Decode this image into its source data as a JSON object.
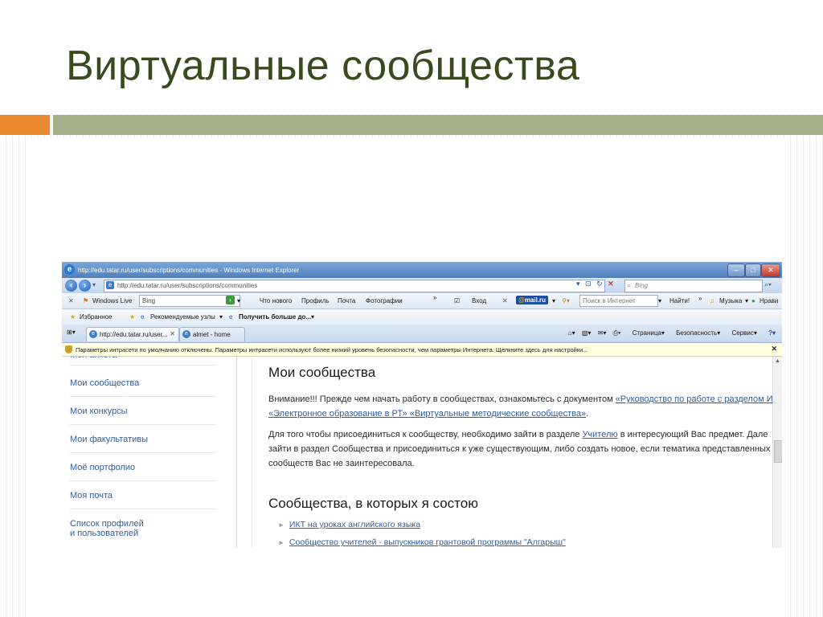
{
  "slide": {
    "title": "Виртуальные сообщества",
    "colors": {
      "title": "#3a4a1f",
      "bar_orange": "#e98b2e",
      "bar_green": "#a3b08a"
    }
  },
  "window": {
    "title": "http://edu.tatar.ru/user/subscriptions/communities - Windows Internet Explorer",
    "controls": {
      "minimize": "–",
      "maximize": "□",
      "close": "✕"
    }
  },
  "address_bar": {
    "url": "http://edu.tatar.ru/user/subscriptions/communities",
    "search_placeholder": "Bing"
  },
  "live_toolbar": {
    "close": "✕",
    "brand": "Windows Live",
    "search_value": "Bing",
    "links": [
      "Что нового",
      "Профиль",
      "Почта",
      "Фотографии"
    ],
    "more": "»",
    "login": "Вход",
    "close2": "✕",
    "mail_prefix": "@",
    "mail_brand": "mail",
    "mail_suffix": ".ru",
    "mail_search_placeholder": "Поиск в Интернет",
    "find_button": "Найти!",
    "more2": "»",
    "music": "Музыка",
    "like": "Нрави"
  },
  "favorites_bar": {
    "favorites": "Избранное",
    "suggested": "Рекомендуемые узлы",
    "get_more": "Получить больше до..."
  },
  "tabs": [
    {
      "label": "http://edu.tatar.ru/user..."
    },
    {
      "label": "almet - home"
    }
  ],
  "command_bar": {
    "page": "Страница",
    "safety": "Безопасность",
    "tools": "Сервис",
    "help": "?"
  },
  "info_bar": {
    "text": "Параметры интрасети по умолчанию отключены. Параметры интрасети используют более низкий уровень безопасности, чем параметры Интернета. Щелкните здесь для настройки...",
    "close": "✕"
  },
  "sidebar": {
    "items": [
      {
        "label": "Моя анкета"
      },
      {
        "label": "Мои сообщества"
      },
      {
        "label": "Мои конкурсы"
      },
      {
        "label": "Мои факультативы"
      },
      {
        "label": "Моё портфолио"
      },
      {
        "label": "Моя почта"
      },
      {
        "label": "Список профилей"
      },
      {
        "label": "и пользователей"
      }
    ]
  },
  "content": {
    "heading": "Мои сообщества",
    "notice_prefix": "Внимание!!! Прежде чем начать работу в сообществах, ознакомьтесь с документом ",
    "notice_link_line1": "«Руководство по работе с разделом И",
    "notice_link_line2": "«Электронное образование в РТ» «Виртуальные методические сообщества»",
    "notice_end": ".",
    "join_prefix": "Для того чтобы присоединиться к сообществу, необходимо зайти в разделе ",
    "join_link": "Учителю",
    "join_suffix": " в интересующий Вас предмет. Дале",
    "join_line2": "зайти в раздел Сообщества и присоединиться к уже существующим, либо создать новое, если тематика представленных",
    "join_line3": "сообществ Вас не заинтересовала.",
    "subheading": "Сообщества, в которых я состою",
    "communities": [
      {
        "label": "ИКТ на уроках английского языка"
      },
      {
        "label": "Сообщество учителей - выпускников грантовой программы \"Алгарыш\""
      }
    ]
  }
}
